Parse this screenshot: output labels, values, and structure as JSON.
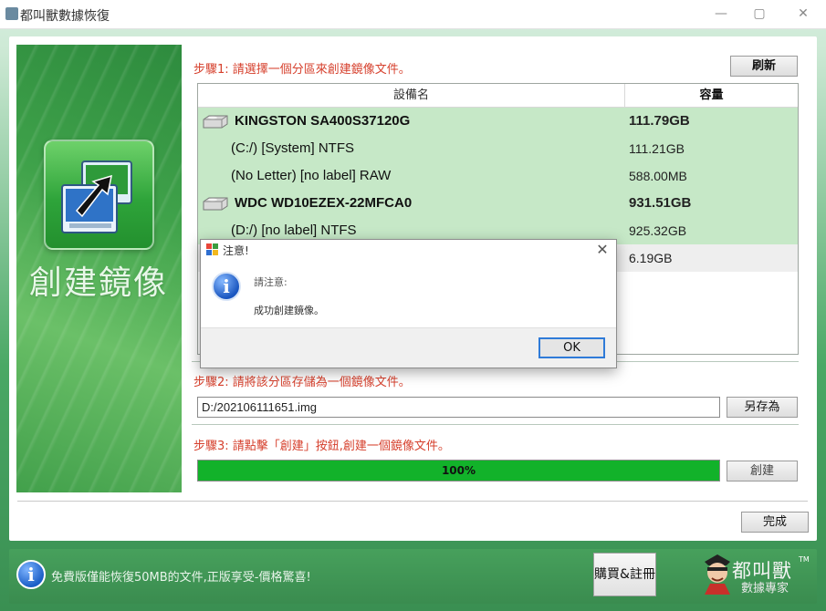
{
  "window": {
    "title": "都叫獸數據恢復",
    "minimize": "—",
    "restore": "▢",
    "close": "✕"
  },
  "banner": {
    "title": "創建鏡像"
  },
  "step1": {
    "label": "步驟1: 請選擇一個分區來創建鏡像文件。",
    "refresh_button": "刷新",
    "columns": {
      "name": "設備名",
      "capacity": "容量"
    },
    "rows": [
      {
        "name": "KINGSTON SA400S37120G",
        "capacity": "111.79GB",
        "type": "disk"
      },
      {
        "name": "(C:/) [System] NTFS",
        "capacity": "111.21GB",
        "type": "partition"
      },
      {
        "name": "(No Letter) [no label] RAW",
        "capacity": "588.00MB",
        "type": "partition"
      },
      {
        "name": "WDC WD10EZEX-22MFCA0",
        "capacity": "931.51GB",
        "type": "disk"
      },
      {
        "name": "(D:/) [no label] NTFS",
        "capacity": "925.32GB",
        "type": "partition"
      },
      {
        "name": "",
        "capacity": "6.19GB",
        "type": "partition-selected"
      }
    ]
  },
  "step2": {
    "label": "步驟2: 請將該分區存儲為一個鏡像文件。",
    "path_value": "D:/202106111651.img",
    "save_as_button": "另存為"
  },
  "step3": {
    "label": "步驟3: 請點擊「創建」按鈕,創建一個鏡像文件。",
    "progress_text": "100%",
    "progress_fraction": 1.0,
    "create_button": "創建"
  },
  "finish_button": "完成",
  "bottom": {
    "notice": "免費版僅能恢復50MB的文件,正版享受-價格驚喜!",
    "buy_button": "購買&註冊",
    "brand_name": "都叫獸",
    "brand_sub": "數據專家",
    "brand_tm": "TM"
  },
  "dialog": {
    "title": "注意!",
    "close": "✕",
    "line1": "請注意:",
    "line2": "成功創建鏡像。",
    "ok_button": "OK"
  },
  "colors": {
    "step_label": "#d6402d",
    "row_highlight": "#c6e8c7",
    "progress_fill": "#12b22a",
    "dialog_ok_border": "#2f7bd8"
  }
}
